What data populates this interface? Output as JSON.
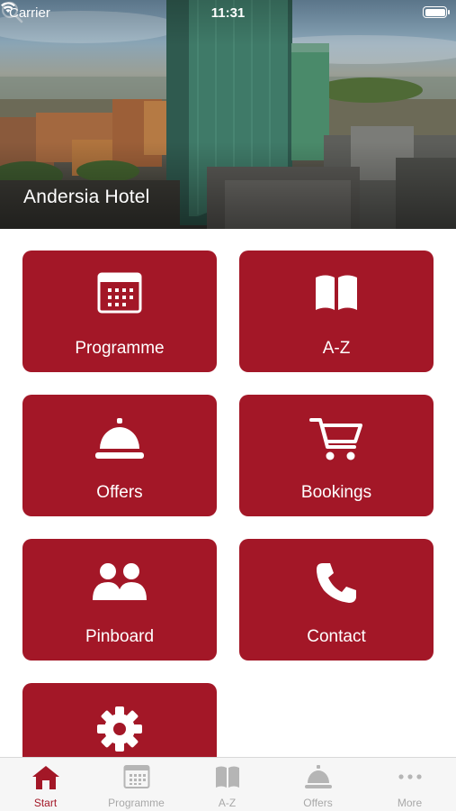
{
  "status_bar": {
    "carrier": "Carrier",
    "time": "11:31"
  },
  "header": {
    "title": "Andersia Hotel",
    "search_icon": "search-icon"
  },
  "tiles": [
    {
      "label": "Programme",
      "icon": "calendar-icon"
    },
    {
      "label": "A-Z",
      "icon": "book-icon"
    },
    {
      "label": "Offers",
      "icon": "service-bell-icon"
    },
    {
      "label": "Bookings",
      "icon": "shopping-cart-icon"
    },
    {
      "label": "Pinboard",
      "icon": "people-icon"
    },
    {
      "label": "Contact",
      "icon": "phone-icon"
    },
    {
      "label": "",
      "icon": "gear-icon"
    }
  ],
  "tabbar": {
    "items": [
      {
        "label": "Start",
        "icon": "home-icon",
        "active": true
      },
      {
        "label": "Programme",
        "icon": "calendar-icon"
      },
      {
        "label": "A-Z",
        "icon": "book-icon"
      },
      {
        "label": "Offers",
        "icon": "service-bell-icon"
      },
      {
        "label": "More",
        "icon": "more-icon"
      }
    ]
  },
  "colors": {
    "accent": "#a31727",
    "tab_inactive": "#a8a8a8",
    "tabbar_bg": "#f6f6f6"
  }
}
